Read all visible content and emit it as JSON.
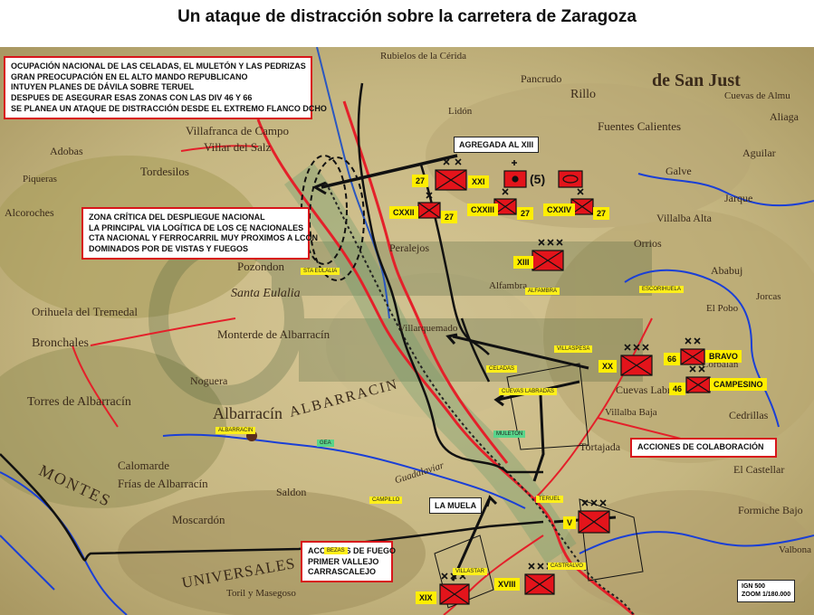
{
  "title": "Un ataque de distracción sobre la carretera de Zaragoza",
  "info_box": [
    "OCUPACIÓN NACIONAL DE LAS CELADAS, EL MULETÓN Y LAS PEDRIZAS",
    "GRAN PREOCUPACIÓN EN EL ALTO MANDO REPUBLICANO",
    "INTUYEN PLANES DE DÁVILA SOBRE TERUEL",
    "DESPUES DE ASEGURAR ESAS ZONAS CON LAS DIV 46 Y 66",
    "SE PLANEA UN ATAQUE DE DISTRACCIÓN DESDE EL EXTREMO FLANCO DCHO"
  ],
  "zone_box": [
    "ZONA CRÍTICA DEL DESPLIEGUE NACIONAL",
    "LA PRINCIPAL VIA LOGÍTICA DE LOS CE̩ NACIONALES",
    "CTA NACIONAL Y FERROCARRIL MUY PROXIMOS A LCON",
    "DOMINADOS POR DE VISTAS Y FUEGOS"
  ],
  "fire_box": [
    "ACCIONES DE FUEGO",
    "PRIMER VALLEJO",
    "CARRASCALEJO"
  ],
  "collab_box": "ACCIONES DE COLABORACIÓN",
  "agregada": "AGREGADA AL XIII",
  "la_muela": "LA MUELA",
  "units": {
    "27a": "27",
    "xxi": "XXI",
    "five": "(5)",
    "cxxii": "CXXII",
    "27b": "27",
    "cxxiii": "CXXIII",
    "27c": "27",
    "cxxiv": "CXXIV",
    "27d": "27",
    "xiii": "XIII",
    "xx": "XX",
    "66": "66",
    "bravo": "BRAVO",
    "46": "46",
    "campesino": "CAMPESINO",
    "v": "V",
    "xix": "XIX",
    "xviii": "XVIII"
  },
  "place_labels": {
    "sta_eulalia": "STA EULALIA",
    "celadas": "CELADAS",
    "muleton": "MULETON",
    "teruel": "TERUEL",
    "albarracin": "ALBARRACIN",
    "alfambra": "ALFAMBRA",
    "escorihuela": "ESCORIHUELA",
    "bezas": "BEZAS",
    "villaspesa": "VILLASPESA",
    "castralvo": "CASTRALVO",
    "campillo": "CAMPILLO",
    "villastar": "VILLASTAR",
    "gea": "GEA",
    "cuevas_labradas": "CUEVAS LABRADAS"
  },
  "map_text": {
    "rubielos": "Rubielos de la Cérida",
    "pancrudo": "Pancrudo",
    "rillo": "Rillo",
    "lidon": "Lidón",
    "sanjust": "de San Just",
    "cuevas_almude": "Cuevas de Almu",
    "fuentes_calientes": "Fuentes Calientes",
    "aliaga": "Aliaga",
    "adobas": "Adobas",
    "villafranca": "Villafranca de Campo",
    "villar_salz": "Villar del Salz",
    "tordesilos": "Tordesilos",
    "piqueras": "Piqueras",
    "alcoroches": "Alcoroches",
    "pozondon": "Pozondon",
    "santa_eulalia": "Santa Eulalia",
    "orihuela": "Orihuela del Tremedal",
    "monterde": "Monterde de Albarracín",
    "bronchales": "Bronchales",
    "noguera": "Noguera",
    "torres": "Torres de Albarracín",
    "albarracin_big": "Albarracín",
    "albarracin_range": "ALBARRACIN",
    "rio_guadalaviar": "Guadalaviar",
    "calomarde": "Calomarde",
    "frias": "Frías de Albarracín",
    "moscardon": "Moscardón",
    "saldon": "Saldon",
    "montes": "MONTES",
    "universales": "UNIVERSALES",
    "toril": "Toril y Masegoso",
    "villalba": "Villalba Alta",
    "orrios": "Orrios",
    "ababuj": "Ababuj",
    "cedrillas": "Cedrillas",
    "el_castellar": "El Castellar",
    "formiche": "Formiche Bajo",
    "cuevas_labradas_map": "Cuevas Labradas",
    "tortajada": "Tortajada",
    "villalba_baja": "Villalba Baja",
    "valbona": "Valbona",
    "alfambra_map": "Alfambra",
    "ababuj_camp": "Peralejos",
    "villarquemado": "Villarquemado",
    "corbalan": "Corbalán",
    "el_pobo": "El Pobo",
    "jorcas": "Jorcas",
    "aguilar": "Aguilar",
    "galve": "Galve",
    "jarque": "Jarque"
  },
  "scale": [
    "IGN 500",
    "ZOOM 1/180.000"
  ],
  "colors": {
    "frame": "#d8151b",
    "unit_fill": "#e3141b",
    "label_yellow": "#ffee00",
    "road_red": "#e4202a",
    "river_blue": "#1a3fd6",
    "black": "#111111",
    "map_bg": "#c9bb89"
  }
}
